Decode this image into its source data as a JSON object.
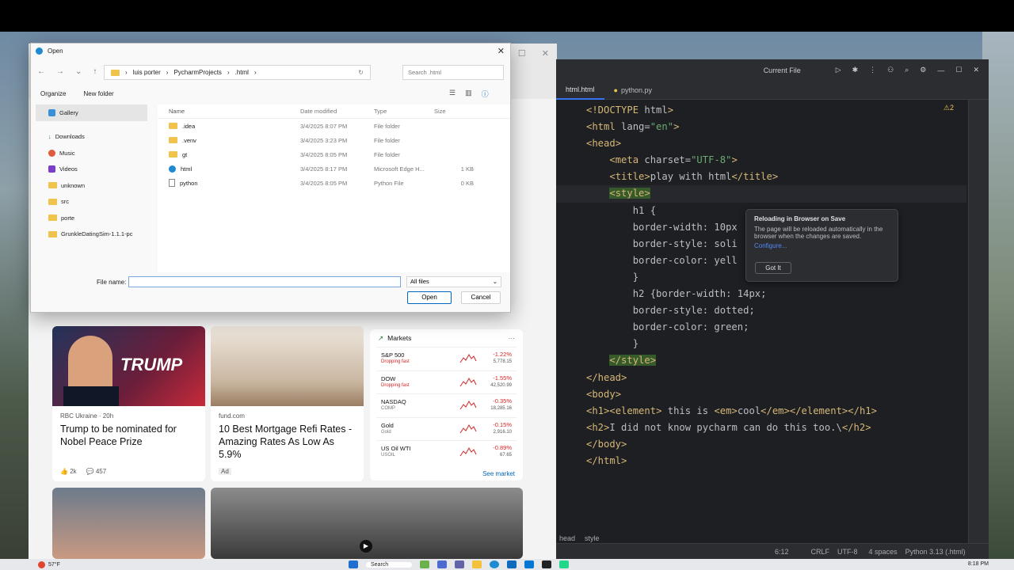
{
  "ide": {
    "run_config": "Current File",
    "tabs": [
      "html.html",
      "python.py"
    ],
    "warnings": "⚠2",
    "breadcrumb": [
      "head",
      "style"
    ],
    "status": {
      "position": "6:12",
      "line_sep": "CRLF",
      "encoding": "UTF-8",
      "indent": "4 spaces",
      "interpreter": "Python 3.13 (.html)"
    },
    "code_lines": [
      "<!DOCTYPE html>",
      "<html lang=\"en\">",
      "<head>",
      "    <meta charset=\"UTF-8\">",
      "    <title>play with html</title>",
      "    <style>",
      "        h1 {",
      "        border-width: 10px",
      "        border-style: soli",
      "        border-color: yell",
      "        }",
      "        h2 {border-width: 14px;",
      "        border-style: dotted;",
      "        border-color: green;",
      "        }",
      "    </style>",
      "</head>",
      "<body>",
      "<h1><element> this is <em>cool</em></element></h1>",
      "<h2>I did not know pycharm can do this too.\\</h2>",
      "</body>",
      "</html>"
    ],
    "popup": {
      "title": "Reloading in Browser on Save",
      "body": "The page will be reloaded automatically in the browser when the changes are saved.",
      "link": "Configure...",
      "button": "Got It"
    }
  },
  "dialog": {
    "title": "Open",
    "path": [
      "luis porter",
      "PycharmProjects",
      ".html"
    ],
    "search_placeholder": "Search .html",
    "toolbar": {
      "organize": "Organize",
      "new_folder": "New folder"
    },
    "nav_items": [
      "Gallery",
      "Downloads",
      "Music",
      "Videos",
      "unknown",
      "src",
      "porte",
      "GrunkleDatingSim-1.1.1-pc"
    ],
    "columns": [
      "Name",
      "Date modified",
      "Type",
      "Size"
    ],
    "files": [
      {
        "name": ".idea",
        "date": "3/4/2025 8:07 PM",
        "type": "File folder",
        "size": ""
      },
      {
        "name": ".venv",
        "date": "3/4/2025 3:23 PM",
        "type": "File folder",
        "size": ""
      },
      {
        "name": "gt",
        "date": "3/4/2025 8:05 PM",
        "type": "File folder",
        "size": ""
      },
      {
        "name": "html",
        "date": "3/4/2025 8:17 PM",
        "type": "Microsoft Edge H...",
        "size": "1 KB"
      },
      {
        "name": "python",
        "date": "3/4/2025 8:05 PM",
        "type": "Python File",
        "size": "0 KB"
      }
    ],
    "filename_label": "File name:",
    "filename_value": "",
    "filetype": "All files",
    "open_label": "Open",
    "cancel_label": "Cancel"
  },
  "browser": {
    "cards": [
      {
        "source": "RBC Ukraine · 20h",
        "title": "Trump to be nominated for Nobel Peace Prize",
        "likes": "2k",
        "comments": "457",
        "image_text": "TRUMP"
      },
      {
        "source": "fund.com",
        "title": "10 Best Mortgage Refi Rates - Amazing Rates As Low As 5.9%",
        "ad": "Ad"
      }
    ],
    "markets": {
      "title": "Markets",
      "see_more": "See market",
      "rows": [
        {
          "name": "S&P 500",
          "sub": "Dropping fast",
          "pct": "-1.22%",
          "val": "5,778.15"
        },
        {
          "name": "DOW",
          "sub": "Dropping fast",
          "pct": "-1.55%",
          "val": "42,520.99"
        },
        {
          "name": "NASDAQ",
          "sub": "COMP",
          "pct": "-0.35%",
          "val": "18,285.16"
        },
        {
          "name": "Gold",
          "sub": "Gold",
          "pct": "-0.15%",
          "val": "2,916.10"
        },
        {
          "name": "US Oil WTI",
          "sub": "USOIL",
          "pct": "-0.89%",
          "val": "67.65"
        }
      ]
    }
  },
  "taskbar": {
    "weather": "57°F",
    "search": "Search",
    "time": "8:18 PM"
  }
}
